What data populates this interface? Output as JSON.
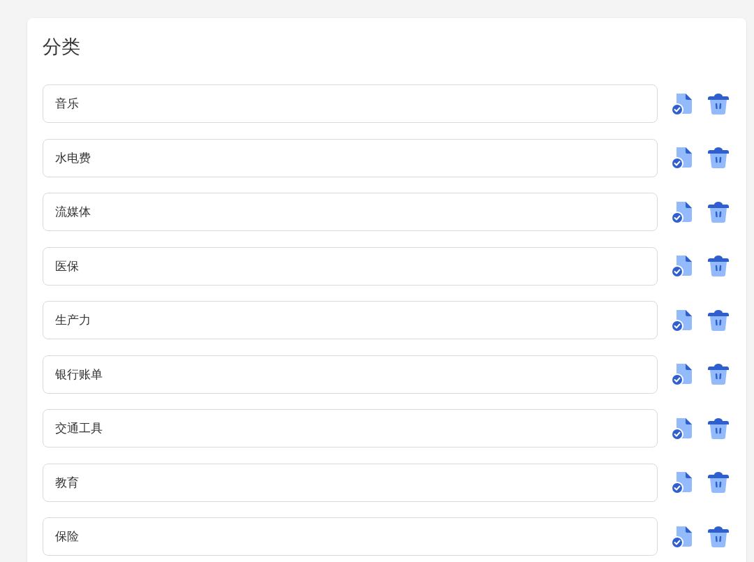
{
  "title": "分类",
  "categories": [
    {
      "value": "音乐"
    },
    {
      "value": "水电费"
    },
    {
      "value": "流媒体"
    },
    {
      "value": "医保"
    },
    {
      "value": "生产力"
    },
    {
      "value": "银行账单"
    },
    {
      "value": "交通工具"
    },
    {
      "value": "教育"
    },
    {
      "value": "保险"
    }
  ]
}
